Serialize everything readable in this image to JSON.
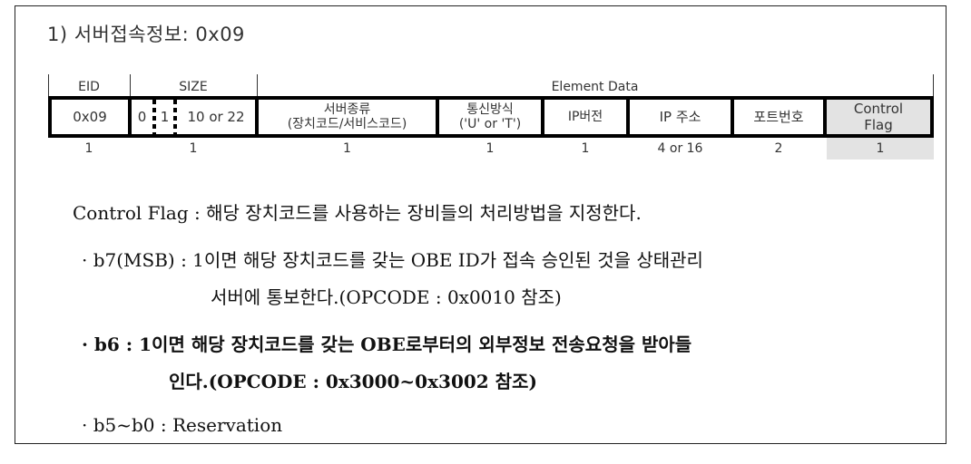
{
  "heading": "1) 서버접속정보: 0x09",
  "table": {
    "headers": {
      "eid": "EID",
      "size": "SIZE",
      "element_data": "Element Data"
    },
    "cells": {
      "eid_value": "0x09",
      "size_parts": [
        "0",
        "1",
        "10 or 22"
      ],
      "server_type_line1": "서버종류",
      "server_type_line2": "(장치코드/서비스코드)",
      "comm_method_line1": "통신방식",
      "comm_method_line2": "('U' or 'T')",
      "ip_version": "IP버전",
      "ip_address": "IP 주소",
      "port_number": "포트번호",
      "control_flag_line1": "Control",
      "control_flag_line2": "Flag"
    },
    "lengths": [
      "1",
      "1",
      "1",
      "1",
      "1",
      "4 or 16",
      "2",
      "1"
    ],
    "highlight_color": "#e3e3e3"
  },
  "description": {
    "intro": "Control Flag : 해당 장치코드를 사용하는 장비들의 처리방법을 지정한다.",
    "b7_line1": "· b7(MSB) : 1이면 해당 장치코드를 갖는 OBE ID가 접속 승인된 것을 상태관리",
    "b7_line2": "서버에 통보한다.(OPCODE : 0x0010 참조)",
    "b6_line1": "· b6 : 1이면 해당 장치코드를 갖는 OBE로부터의 외부정보 전송요청을 받아들",
    "b6_line2": "인다.(OPCODE : 0x3000~0x3002 참조)",
    "b5_b0": "· b5~b0 : Reservation"
  }
}
